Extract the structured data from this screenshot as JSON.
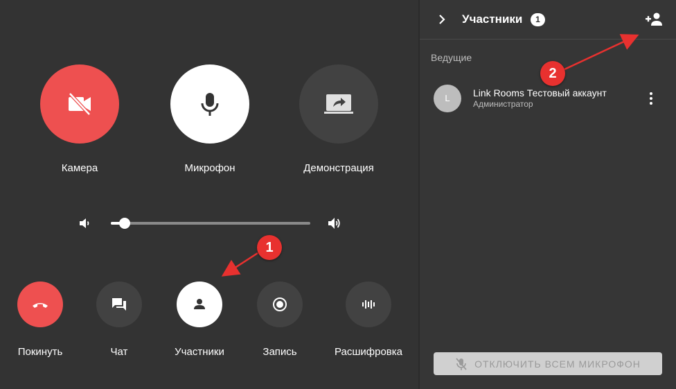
{
  "main": {
    "big_buttons": [
      {
        "label": "Камера",
        "icon": "camera-off-icon",
        "state": "off"
      },
      {
        "label": "Микрофон",
        "icon": "microphone-icon",
        "state": "on"
      },
      {
        "label": "Демонстрация",
        "icon": "screen-share-icon",
        "state": "off"
      }
    ],
    "volume": {
      "level": 0.07
    },
    "small_buttons": [
      {
        "label": "Покинуть",
        "icon": "hang-up-icon"
      },
      {
        "label": "Чат",
        "icon": "chat-icon"
      },
      {
        "label": "Участники",
        "icon": "participants-icon"
      },
      {
        "label": "Запись",
        "icon": "record-icon"
      },
      {
        "label": "Расшифровка",
        "icon": "transcription-icon"
      }
    ]
  },
  "sidebar": {
    "title": "Участники",
    "count": "1",
    "section_label": "Ведущие",
    "participants": [
      {
        "initial": "L",
        "name": "Link Rooms Тестовый аккаунт",
        "role": "Администратор"
      }
    ],
    "mute_all_label": "ОТКЛЮЧИТЬ ВСЕМ МИКРОФОН"
  },
  "annotations": [
    {
      "number": "1"
    },
    {
      "number": "2"
    }
  ],
  "colors": {
    "background": "#333333",
    "sidebar": "#363636",
    "danger": "#ee5050",
    "dark_button": "#424242",
    "light_button": "#ffffff",
    "callout": "#e8312f"
  }
}
